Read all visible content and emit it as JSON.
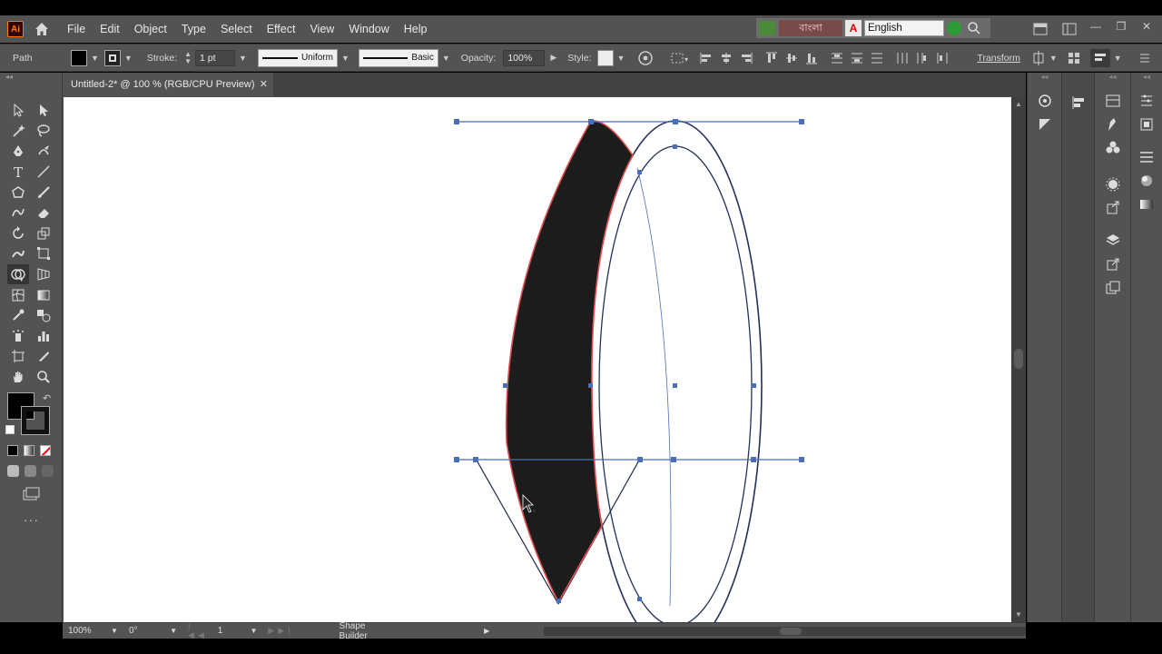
{
  "app": {
    "logo_text": "Ai",
    "menu": [
      "File",
      "Edit",
      "Object",
      "Type",
      "Select",
      "Effect",
      "View",
      "Window",
      "Help"
    ]
  },
  "ime": {
    "bengali_text": "বাংলা",
    "language": "English"
  },
  "control_bar": {
    "selection_type": "Path",
    "stroke_label": "Stroke:",
    "stroke_weight": "1 pt",
    "variable_width": "Uniform",
    "brush": "Basic",
    "opacity_label": "Opacity:",
    "opacity_value": "100%",
    "style_label": "Style:",
    "transform_label": "Transform"
  },
  "document": {
    "tab_title": "Untitled-2* @ 100 % (RGB/CPU Preview)"
  },
  "status_bar": {
    "zoom": "100%",
    "rotation": "0°",
    "artboard_number": "1",
    "current_tool": "Shape Builder"
  },
  "colors": {
    "fill": "#000000",
    "stroke_highlight": "#e05050",
    "selection_blue": "#4a6fb8",
    "panel": "#535353"
  },
  "tools": [
    "selection-tool",
    "direct-selection-tool",
    "magic-wand-tool",
    "lasso-tool",
    "pen-tool",
    "curvature-tool",
    "type-tool",
    "line-segment-tool",
    "ellipse-tool",
    "paintbrush-tool",
    "shaper-tool",
    "eraser-tool",
    "rotate-tool",
    "scale-tool",
    "warp-tool",
    "free-transform-tool",
    "shape-builder-tool",
    "perspective-grid-tool",
    "mesh-tool",
    "gradient-tool",
    "eyedropper-tool",
    "blend-tool",
    "symbol-sprayer-tool",
    "column-graph-tool",
    "artboard-tool",
    "slice-tool",
    "hand-tool",
    "zoom-tool"
  ]
}
